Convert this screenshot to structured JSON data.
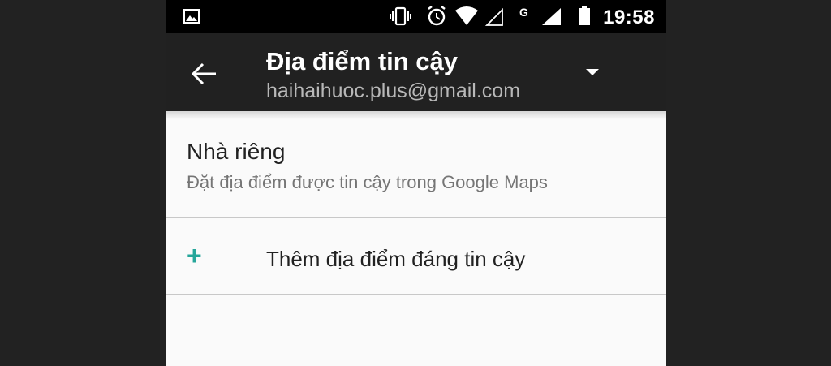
{
  "status_bar": {
    "time": "19:58",
    "icons": [
      "gallery-icon",
      "vibrate-icon",
      "alarm-icon",
      "wifi-icon",
      "signal-empty-icon",
      "g-network-icon",
      "signal-icon",
      "battery-icon"
    ],
    "network_label": "G"
  },
  "app_bar": {
    "title": "Địa điểm tin cậy",
    "subtitle": "haihaihuoc.plus@gmail.com",
    "icons": [
      "arrow-back-icon",
      "dropdown-arrow-icon"
    ]
  },
  "list": {
    "home": {
      "title": "Nhà riêng",
      "subtitle": "Đặt địa điểm được tin cậy trong Google Maps"
    },
    "add": {
      "icon": "plus-icon",
      "label": "Thêm địa điểm đáng tin cậy"
    }
  },
  "colors": {
    "status_bar": "#000000",
    "app_bar": "#212121",
    "background": "#fafafa",
    "accent": "#26a69a",
    "outer": "#222222"
  }
}
